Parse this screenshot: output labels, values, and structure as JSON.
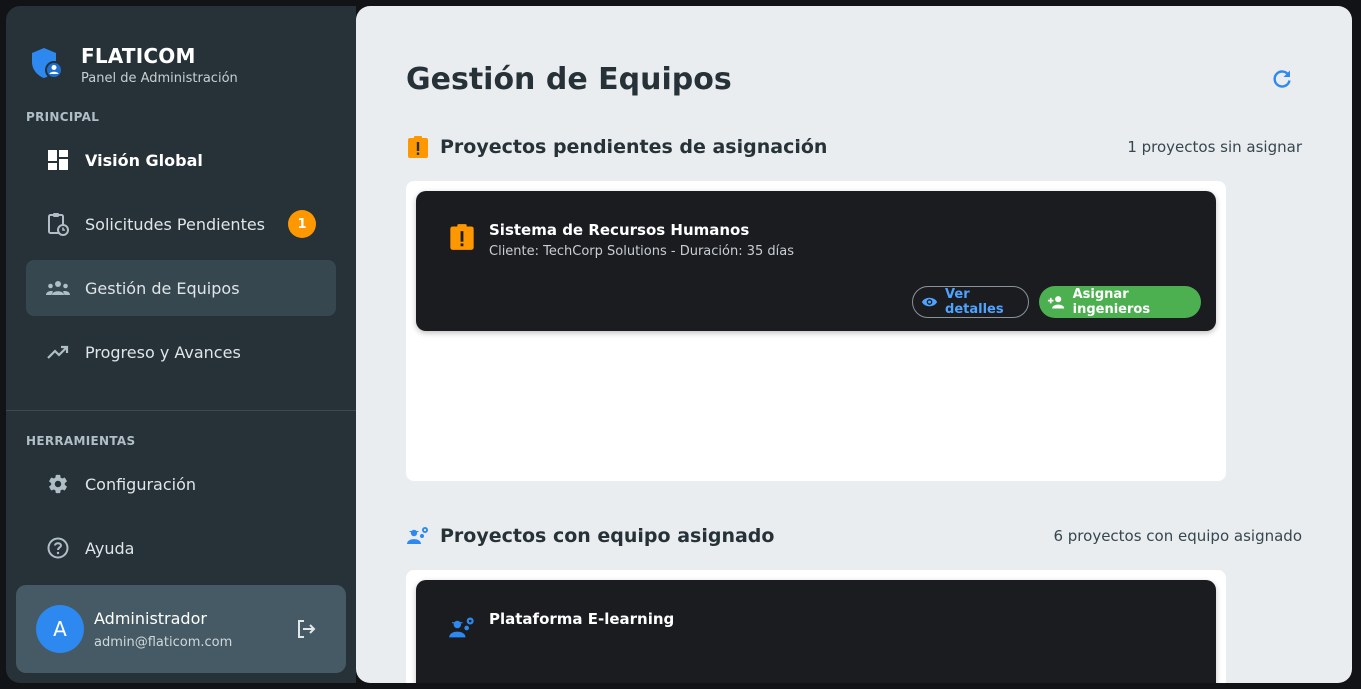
{
  "brand": {
    "name": "FLATICOM",
    "subtitle": "Panel de Administración"
  },
  "sidebar": {
    "section_principal": "PRINCIPAL",
    "items": [
      {
        "label": "Visión Global",
        "icon": "dashboard-icon"
      },
      {
        "label": "Solicitudes Pendientes",
        "icon": "clipboard-clock-icon",
        "badge": "1"
      },
      {
        "label": "Gestión de Equipos",
        "icon": "groups-icon",
        "selected": true
      },
      {
        "label": "Progreso y Avances",
        "icon": "trending-up-icon"
      }
    ],
    "section_tools": "HERRAMIENTAS",
    "tools": [
      {
        "label": "Configuración",
        "icon": "gear-icon"
      },
      {
        "label": "Ayuda",
        "icon": "help-icon"
      }
    ]
  },
  "user": {
    "initial": "A",
    "name": "Administrador",
    "email": "admin@flaticom.com"
  },
  "main": {
    "title": "Gestión de Equipos",
    "pending": {
      "title": "Proyectos pendientes de asignación",
      "count": "1 proyectos sin asignar",
      "cards": [
        {
          "title": "Sistema de Recursos Humanos",
          "subtitle": "Cliente: TechCorp Solutions - Duración: 35 días",
          "view_label": "Ver detalles",
          "assign_label": "Asignar ingenieros"
        }
      ]
    },
    "assigned": {
      "title": "Proyectos con equipo asignado",
      "count": "6 proyectos con equipo asignado",
      "cards": [
        {
          "title": "Plataforma E-learning"
        }
      ]
    }
  },
  "colors": {
    "sidebar_bg": "#263238",
    "accent_blue": "#2d89ef",
    "warning_orange": "#ff9800",
    "success_green": "#4caf50",
    "main_bg": "#e9edf0"
  }
}
